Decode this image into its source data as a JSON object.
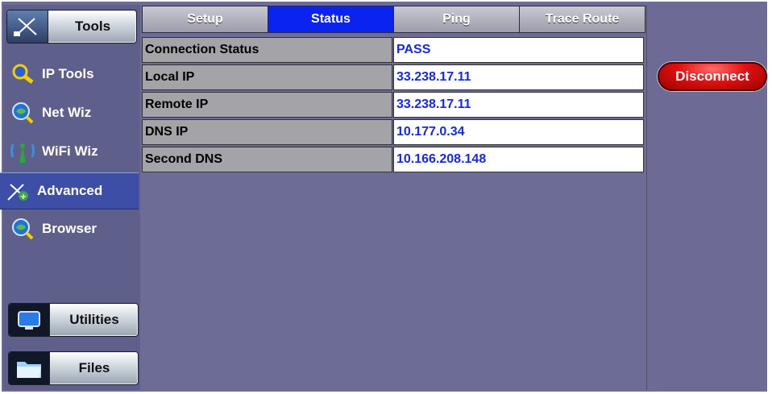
{
  "sidebar": {
    "top_button": {
      "label": "Tools",
      "icon": "tools-icon"
    },
    "items": [
      {
        "label": "IP Tools",
        "icon": "magnifier-icon",
        "active": false
      },
      {
        "label": "Net Wiz",
        "icon": "globe-magnifier-icon",
        "active": false
      },
      {
        "label": "WiFi Wiz",
        "icon": "wifi-antenna-icon",
        "active": false
      },
      {
        "label": "Advanced",
        "icon": "advanced-tools-icon",
        "active": true
      },
      {
        "label": "Browser",
        "icon": "browser-globe-icon",
        "active": false
      }
    ],
    "bottom_buttons": [
      {
        "label": "Utilities",
        "icon": "monitor-icon"
      },
      {
        "label": "Files",
        "icon": "folder-icon"
      }
    ]
  },
  "tabs": [
    {
      "label": "Setup",
      "active": false
    },
    {
      "label": "Status",
      "active": true
    },
    {
      "label": "Ping",
      "active": false
    },
    {
      "label": "Trace Route",
      "active": false
    }
  ],
  "status_table": [
    {
      "label": "Connection Status",
      "value": "PASS"
    },
    {
      "label": "Local IP",
      "value": "33.238.17.11"
    },
    {
      "label": "Remote IP",
      "value": "33.238.17.11"
    },
    {
      "label": "DNS IP",
      "value": "10.177.0.34"
    },
    {
      "label": "Second DNS",
      "value": "10.166.208.148"
    }
  ],
  "actions": {
    "disconnect_label": "Disconnect"
  },
  "colors": {
    "background": "#6c6c96",
    "active_tab": "#0a23f0",
    "value_text": "#1428e8",
    "disconnect": "#e01010",
    "active_sidebar": "#3d4ea6"
  }
}
